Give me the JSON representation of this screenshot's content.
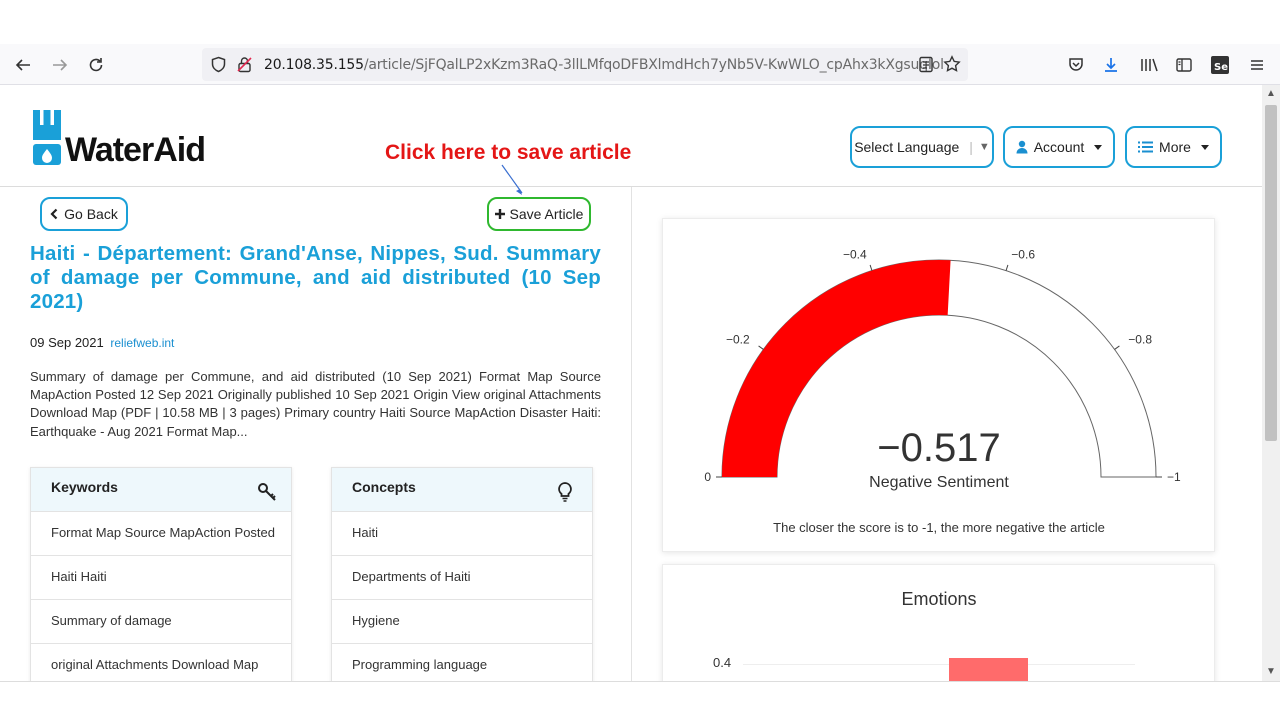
{
  "browser": {
    "url_host": "20.108.35.155",
    "url_path": "/article/SjFQalLP2xKzm3RaQ-3llLMfqoDFBXlmdHch7yNb5V-KwWLO_cpAhx3kXgsuqIol"
  },
  "header": {
    "logo_text": "WaterAid",
    "select_language": "Select Language",
    "account": "Account",
    "more": "More"
  },
  "annotation": {
    "text": "Click here to save article",
    "color": "#e41616"
  },
  "article": {
    "go_back": "Go Back",
    "save": "Save Article",
    "title": "Haiti - Département: Grand'Anse, Nippes, Sud. Summary of damage per Commune, and aid distributed (10 Sep 2021)",
    "date": "09 Sep 2021",
    "source": "reliefweb.int",
    "summary": "Summary of damage per Commune, and aid distributed (10 Sep 2021) Format Map Source MapAction Posted 12 Sep 2021 Originally published 10 Sep 2021 Origin View original Attachments Download Map (PDF | 10.58 MB | 3 pages) Primary country Haiti Source MapAction Disaster Haiti: Earthquake - Aug 2021 Format Map..."
  },
  "keywords": {
    "heading": "Keywords",
    "items": [
      "Format Map Source MapAction Posted",
      "Haiti Haiti",
      "Summary of damage",
      "original Attachments Download Map"
    ]
  },
  "concepts": {
    "heading": "Concepts",
    "items": [
      "Haiti",
      "Departments of Haiti",
      "Hygiene",
      "Programming language"
    ]
  },
  "sentiment": {
    "score_text": "−0.517",
    "label": "Negative Sentiment",
    "note": "The closer the score is to -1, the more negative the article",
    "fill_color": "#ff0000"
  },
  "chart_data": {
    "type": "gauge",
    "value": -0.517,
    "range": [
      0,
      -1
    ],
    "ticks": [
      "0",
      "−0.2",
      "−0.4",
      "−0.6",
      "−0.8",
      "−1"
    ]
  },
  "emotions": {
    "title": "Emotions",
    "y_tick": "0.4",
    "bar_color": "#ff6b6b"
  }
}
